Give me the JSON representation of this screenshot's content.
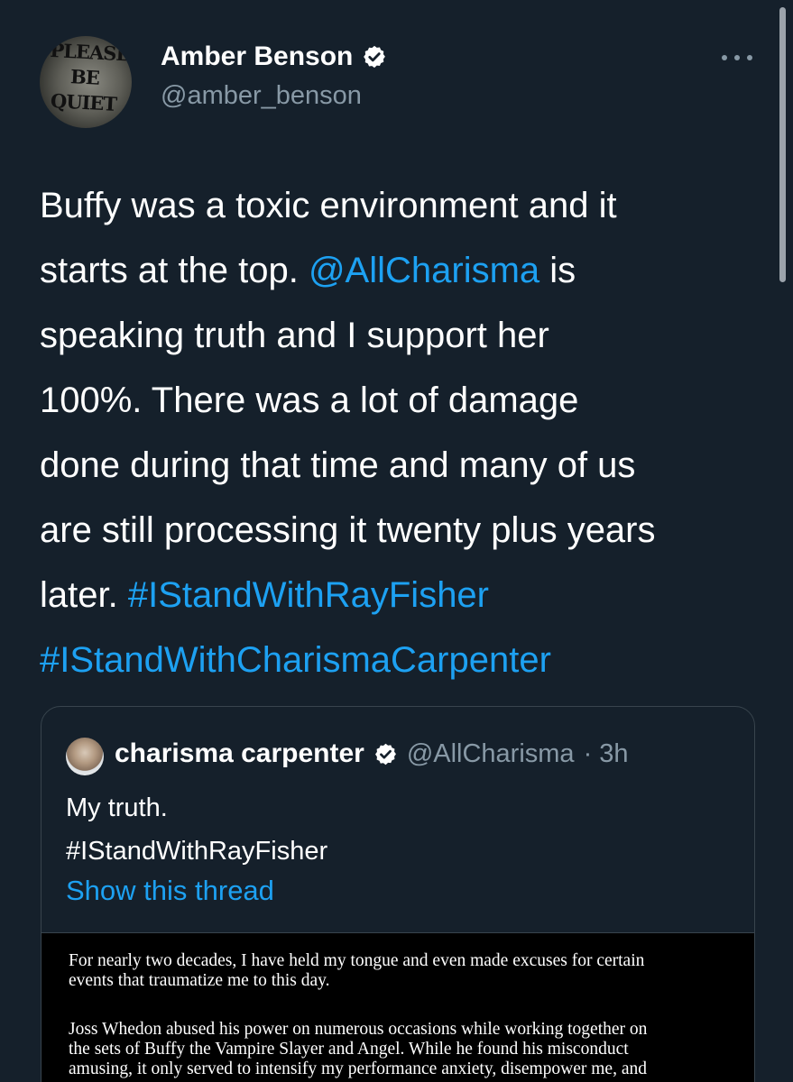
{
  "tweet": {
    "author": {
      "name": "Amber Benson",
      "handle": "@amber_benson",
      "avatar_text": [
        "PLEASE",
        "BE",
        "QUIET"
      ]
    },
    "text_lines": [
      "Buffy was a toxic environment and it",
      [
        "starts at the top. ",
        "@AllCharisma",
        " is"
      ],
      "speaking truth and I support her",
      "100%. There was a lot of damage",
      "done during that time and many of us",
      "are still processing it twenty plus years",
      [
        "later. ",
        "#IStandWithRayFisher",
        ""
      ],
      [
        "",
        "#IStandWithCharismaCarpenter",
        ""
      ]
    ],
    "more_icon": "ellipsis-icon",
    "link_color": "#1da1f2"
  },
  "quote": {
    "author_name": "charisma carpenter",
    "author_handle": "@AllCharisma",
    "time": "· 3h",
    "text_lines": [
      "My truth.",
      "#IStandWithRayFisher"
    ],
    "show_thread": "Show this thread",
    "document": {
      "paragraph1": [
        "For nearly two decades, I have held my tongue and even made excuses for certain",
        "events that traumatize me to this day."
      ],
      "paragraph2": [
        "Joss Whedon abused his power on numerous occasions while working together on",
        "the sets of Buffy the Vampire Slayer and Angel. While he found his misconduct",
        "amusing, it only served to intensify my performance anxiety, disempower me, and"
      ]
    }
  },
  "colors": {
    "background": "#15202b",
    "secondary_text": "#8899a6",
    "accent": "#1da1f2",
    "border": "#38444d"
  }
}
